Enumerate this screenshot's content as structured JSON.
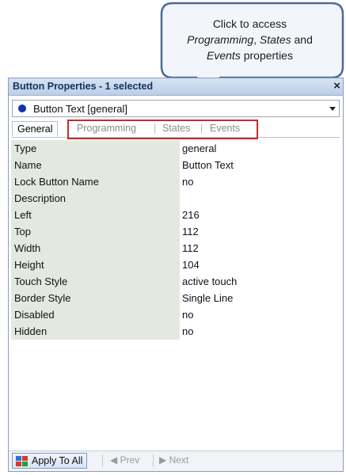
{
  "callout": {
    "line1": "Click to access",
    "line2_a": "Programming",
    "line2_b": ", ",
    "line2_c": "States",
    "line2_d": " and",
    "line3_a": "Events",
    "line3_b": " properties"
  },
  "panel": {
    "title": "Button Properties - 1 selected",
    "close": "×",
    "selector": {
      "label": "Button Text  [general]"
    },
    "tabs": [
      {
        "label": "General"
      },
      {
        "label": "Programming"
      },
      {
        "label": "States"
      },
      {
        "label": "Events"
      }
    ],
    "tab_separator": "|",
    "properties": [
      {
        "name": "Type",
        "value": "general"
      },
      {
        "name": "Name",
        "value": "Button Text"
      },
      {
        "name": "Lock Button Name",
        "value": "no"
      },
      {
        "name": "Description",
        "value": ""
      },
      {
        "name": "Left",
        "value": "216"
      },
      {
        "name": "Top",
        "value": "112"
      },
      {
        "name": "Width",
        "value": "112"
      },
      {
        "name": "Height",
        "value": "104"
      },
      {
        "name": "Touch Style",
        "value": "active touch"
      },
      {
        "name": "Border Style",
        "value": "Single Line"
      },
      {
        "name": "Disabled",
        "value": "no"
      },
      {
        "name": "Hidden",
        "value": "no"
      }
    ],
    "bottom": {
      "apply_label": "Apply To All",
      "prev_label": "Prev",
      "next_label": "Next"
    }
  },
  "colors": {
    "highlight": "#cc2a2a",
    "callout_fill": "#f2f6fc",
    "callout_border": "#4c6a99",
    "name_column_bg": "#e3e9e1"
  }
}
